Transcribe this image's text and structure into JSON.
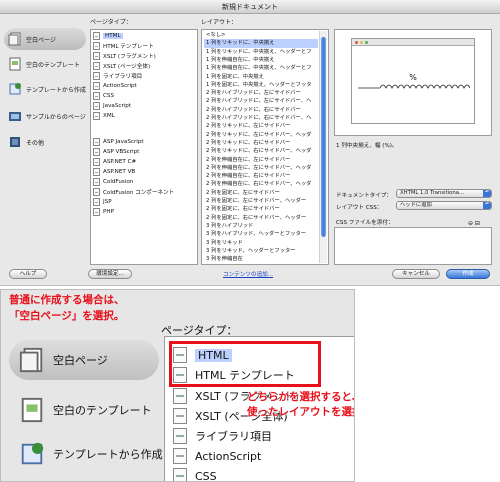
{
  "dialog": {
    "title": "新規ドキュメント",
    "sidebar": [
      {
        "label": "空白ページ",
        "icon": "blank-page-icon",
        "selected": true
      },
      {
        "label": "空白のテンプレート",
        "icon": "blank-template-icon",
        "selected": false
      },
      {
        "label": "テンプレートから作成",
        "icon": "template-icon",
        "selected": false
      },
      {
        "label": "サンプルからのページ",
        "icon": "sample-page-icon",
        "selected": false
      },
      {
        "label": "その他",
        "icon": "other-icon",
        "selected": false
      }
    ],
    "page_type_header": "ページタイプ：",
    "page_types": [
      "HTML",
      "HTML テンプレート",
      "XSLT (フラグメント)",
      "XSLT (ページ全体)",
      "ライブラリ項目",
      "ActionScript",
      "CSS",
      "JavaScript",
      "XML",
      "",
      "ASP JavaScript",
      "ASP VBScript",
      "ASP.NET C#",
      "ASP.NET VB",
      "ColdFusion",
      "ColdFusion コンポーネント",
      "JSP",
      "PHP"
    ],
    "layout_header": "レイアウト：",
    "layouts": [
      "<なし>",
      "1 列をリキッドに、中央揃え",
      "1 列をリキッドに、中央揃え、ヘッダーとフ",
      "1 列を伸縮自在に、中央揃え",
      "1 列を伸縮自在に、中央揃え、ヘッダーとフ",
      "1 列を固定に、中央揃え",
      "1 列を固定に、中央揃え、ヘッダーとフッタ",
      "2 列をハイブリッドに、左にサイドバー",
      "2 列をハイブリッドに、左にサイドバー、ヘ",
      "2 列をハイブリッドに、右にサイドバー",
      "2 列をハイブリッドに、右にサイドバー、ヘ",
      "2 列をリキッドに、左にサイドバー",
      "2 列をリキッドに、左にサイドバー、ヘッダ",
      "2 列をリキッドに、右にサイドバー",
      "2 列をリキッドに、右にサイドバー、ヘッダ",
      "2 列を伸縮自在に、左にサイドバー",
      "2 列を伸縮自在に、左にサイドバー、ヘッダ",
      "2 列を伸縮自在に、右にサイドバー",
      "2 列を伸縮自在に、右にサイドバー、ヘッダ",
      "2 列を固定に、左にサイドバー",
      "2 列を固定に、左にサイドバー、ヘッダー",
      "2 列を固定に、右にサイドバー",
      "2 列を固定に、右にサイドバー、ヘッダー",
      "3 列をハイブリッド",
      "3 列をハイブリッド、ヘッダーとフッター",
      "3 列をリキッド",
      "3 列をリキッド、ヘッダーとフッター",
      "3 列を伸縮自在"
    ],
    "selected_layout_index": 1,
    "preview_percent": "%",
    "description": "1 列中央揃え、幅 (%)。",
    "doctype_label": "ドキュメントタイプ：",
    "doctype_value": "XHTML 1.0 Transitiona...",
    "layout_css_label": "レイアウト CSS：",
    "layout_css_value": "ヘッドに追加",
    "attach_css_label": "CSS ファイルを添付：",
    "attach_css_tools": "⊖ ⊟",
    "help_button": "ヘルプ",
    "prefs_button": "環境設定...",
    "content_link": "コンテンツの追加...",
    "cancel_button": "キャンセル",
    "create_button": "作成"
  },
  "zoom": {
    "note_line1": "普通に作成する場合は、",
    "note_line2": "「空白ページ」を選択。",
    "page_type_header": "ページタイプ：",
    "sidebar": [
      {
        "label": "空白ページ",
        "selected": true
      },
      {
        "label": "空白のテンプレート",
        "selected": false
      },
      {
        "label": "テンプレートから作成",
        "selected": false
      }
    ],
    "items": [
      "HTML",
      "HTML テンプレート",
      "XSLT (フラグメント)",
      "XSLT (ページ全体)",
      "ライブラリ項目",
      "ActionScript",
      "CSS"
    ],
    "callout_line1": "どちらかを選択すると、CSSを",
    "callout_line2": "使ったレイアウトを選択できる。",
    "accent_color": "#e8101a",
    "selection_color": "#bcd0ff"
  }
}
